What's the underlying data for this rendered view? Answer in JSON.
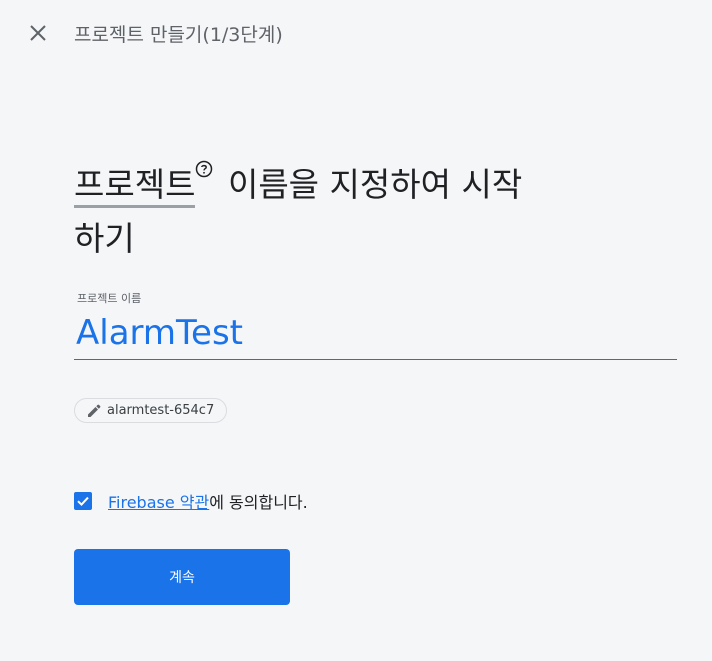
{
  "header": {
    "close_icon": "close-icon",
    "step_title": "프로젝트 만들기(1/3단계)"
  },
  "heading": {
    "term": "프로젝트",
    "help_icon": "help-circle-icon",
    "rest_line1": "이름을 지정하여 시작",
    "rest_line2": "하기"
  },
  "form": {
    "name_label": "프로젝트 이름",
    "name_value": "AlarmTest",
    "project_id": "alarmtest-654c7",
    "edit_icon": "pencil-icon"
  },
  "agreement": {
    "checked": true,
    "link_text": "Firebase 약관",
    "suffix_text": "에 동의합니다."
  },
  "actions": {
    "continue_label": "계속"
  },
  "colors": {
    "accent": "#1a73e8",
    "background": "#f4f6f8",
    "text": "#202124",
    "muted": "#5f6368"
  }
}
